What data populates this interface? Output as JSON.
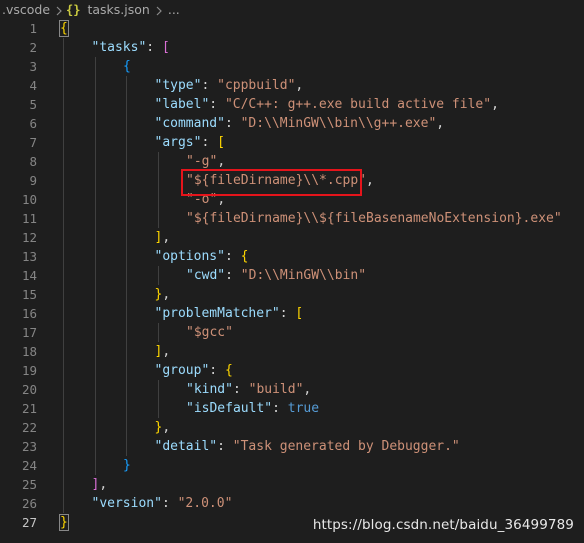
{
  "breadcrumb": {
    "folder": ".vscode",
    "file_icon": "{}",
    "file": "tasks.json",
    "more": "..."
  },
  "lines": [
    {
      "n": "1",
      "indent": 0,
      "tokens": [
        {
          "t": "{",
          "c": "brace-1"
        }
      ]
    },
    {
      "n": "2",
      "indent": 1,
      "tokens": [
        {
          "t": "\"tasks\"",
          "c": "key"
        },
        {
          "t": ": ",
          "c": "punc"
        },
        {
          "t": "[",
          "c": "brace-2"
        }
      ]
    },
    {
      "n": "3",
      "indent": 2,
      "tokens": [
        {
          "t": "{",
          "c": "brace-3"
        }
      ]
    },
    {
      "n": "4",
      "indent": 3,
      "tokens": [
        {
          "t": "\"type\"",
          "c": "key"
        },
        {
          "t": ": ",
          "c": "punc"
        },
        {
          "t": "\"cppbuild\"",
          "c": "str"
        },
        {
          "t": ",",
          "c": "punc"
        }
      ]
    },
    {
      "n": "5",
      "indent": 3,
      "tokens": [
        {
          "t": "\"label\"",
          "c": "key"
        },
        {
          "t": ": ",
          "c": "punc"
        },
        {
          "t": "\"C/C++: g++.exe build active file\"",
          "c": "str"
        },
        {
          "t": ",",
          "c": "punc"
        }
      ]
    },
    {
      "n": "6",
      "indent": 3,
      "tokens": [
        {
          "t": "\"command\"",
          "c": "key"
        },
        {
          "t": ": ",
          "c": "punc"
        },
        {
          "t": "\"D:\\\\MinGW\\\\bin\\\\g++.exe\"",
          "c": "str"
        },
        {
          "t": ",",
          "c": "punc"
        }
      ]
    },
    {
      "n": "7",
      "indent": 3,
      "tokens": [
        {
          "t": "\"args\"",
          "c": "key"
        },
        {
          "t": ": ",
          "c": "punc"
        },
        {
          "t": "[",
          "c": "brace-1"
        }
      ]
    },
    {
      "n": "8",
      "indent": 4,
      "tokens": [
        {
          "t": "\"-g\"",
          "c": "str"
        },
        {
          "t": ",",
          "c": "punc"
        }
      ]
    },
    {
      "n": "9",
      "indent": 4,
      "tokens": [
        {
          "t": "\"${fileDirname}\\\\*.cpp\"",
          "c": "str"
        },
        {
          "t": ",",
          "c": "punc"
        }
      ]
    },
    {
      "n": "10",
      "indent": 4,
      "tokens": [
        {
          "t": "\"-o\"",
          "c": "str"
        },
        {
          "t": ",",
          "c": "punc"
        }
      ]
    },
    {
      "n": "11",
      "indent": 4,
      "tokens": [
        {
          "t": "\"${fileDirname}\\\\${fileBasenameNoExtension}.exe\"",
          "c": "str"
        }
      ]
    },
    {
      "n": "12",
      "indent": 3,
      "tokens": [
        {
          "t": "]",
          "c": "brace-1"
        },
        {
          "t": ",",
          "c": "punc"
        }
      ]
    },
    {
      "n": "13",
      "indent": 3,
      "tokens": [
        {
          "t": "\"options\"",
          "c": "key"
        },
        {
          "t": ": ",
          "c": "punc"
        },
        {
          "t": "{",
          "c": "brace-1"
        }
      ]
    },
    {
      "n": "14",
      "indent": 4,
      "tokens": [
        {
          "t": "\"cwd\"",
          "c": "key"
        },
        {
          "t": ": ",
          "c": "punc"
        },
        {
          "t": "\"D:\\\\MinGW\\\\bin\"",
          "c": "str"
        }
      ]
    },
    {
      "n": "15",
      "indent": 3,
      "tokens": [
        {
          "t": "}",
          "c": "brace-1"
        },
        {
          "t": ",",
          "c": "punc"
        }
      ]
    },
    {
      "n": "16",
      "indent": 3,
      "tokens": [
        {
          "t": "\"problemMatcher\"",
          "c": "key"
        },
        {
          "t": ": ",
          "c": "punc"
        },
        {
          "t": "[",
          "c": "brace-1"
        }
      ]
    },
    {
      "n": "17",
      "indent": 4,
      "tokens": [
        {
          "t": "\"$gcc\"",
          "c": "str"
        }
      ]
    },
    {
      "n": "18",
      "indent": 3,
      "tokens": [
        {
          "t": "]",
          "c": "brace-1"
        },
        {
          "t": ",",
          "c": "punc"
        }
      ]
    },
    {
      "n": "19",
      "indent": 3,
      "tokens": [
        {
          "t": "\"group\"",
          "c": "key"
        },
        {
          "t": ": ",
          "c": "punc"
        },
        {
          "t": "{",
          "c": "brace-1"
        }
      ]
    },
    {
      "n": "20",
      "indent": 4,
      "tokens": [
        {
          "t": "\"kind\"",
          "c": "key"
        },
        {
          "t": ": ",
          "c": "punc"
        },
        {
          "t": "\"build\"",
          "c": "str"
        },
        {
          "t": ",",
          "c": "punc"
        }
      ]
    },
    {
      "n": "21",
      "indent": 4,
      "tokens": [
        {
          "t": "\"isDefault\"",
          "c": "key"
        },
        {
          "t": ": ",
          "c": "punc"
        },
        {
          "t": "true",
          "c": "kw"
        }
      ]
    },
    {
      "n": "22",
      "indent": 3,
      "tokens": [
        {
          "t": "}",
          "c": "brace-1"
        },
        {
          "t": ",",
          "c": "punc"
        }
      ]
    },
    {
      "n": "23",
      "indent": 3,
      "tokens": [
        {
          "t": "\"detail\"",
          "c": "key"
        },
        {
          "t": ": ",
          "c": "punc"
        },
        {
          "t": "\"Task generated by Debugger.\"",
          "c": "str"
        }
      ]
    },
    {
      "n": "24",
      "indent": 2,
      "tokens": [
        {
          "t": "}",
          "c": "brace-3"
        }
      ]
    },
    {
      "n": "25",
      "indent": 1,
      "tokens": [
        {
          "t": "]",
          "c": "brace-2"
        },
        {
          "t": ",",
          "c": "punc"
        }
      ]
    },
    {
      "n": "26",
      "indent": 1,
      "tokens": [
        {
          "t": "\"version\"",
          "c": "key"
        },
        {
          "t": ": ",
          "c": "punc"
        },
        {
          "t": "\"2.0.0\"",
          "c": "str"
        }
      ]
    },
    {
      "n": "27",
      "indent": 0,
      "tokens": [
        {
          "t": "}",
          "c": "brace-1"
        }
      ],
      "active": true
    }
  ],
  "highlighted_line": "9",
  "watermark": "https://blog.csdn.net/baidu_36499789",
  "colors": {
    "background": "#1e1e1e",
    "key": "#9cdcfe",
    "string": "#ce9178",
    "keyword": "#569cd6",
    "highlight_border": "#e5141b"
  }
}
